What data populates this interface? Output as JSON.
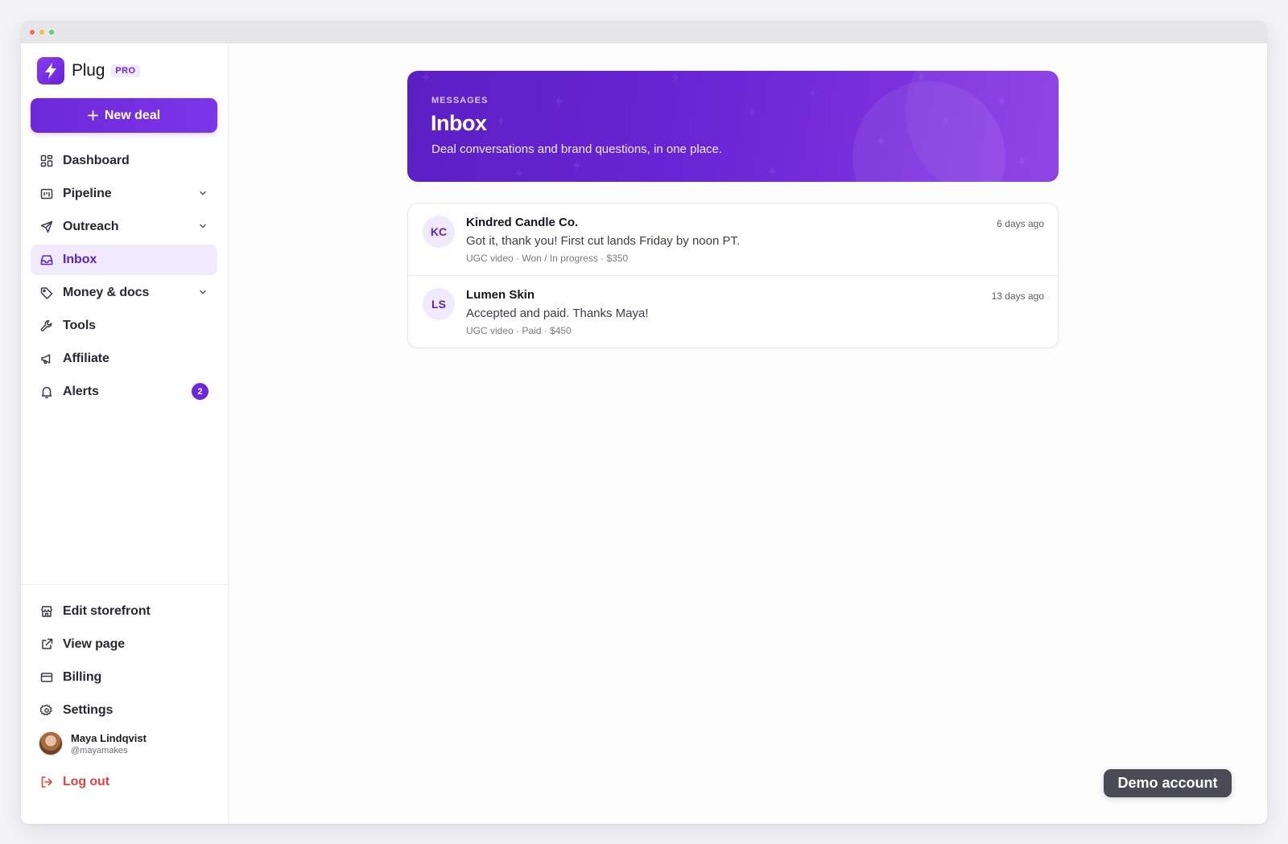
{
  "brand": {
    "name": "Plug",
    "badge": "PRO"
  },
  "sidebar": {
    "new_deal_label": "New deal",
    "items": [
      {
        "label": "Dashboard",
        "icon": "grid-icon",
        "has_chevron": false
      },
      {
        "label": "Pipeline",
        "icon": "pipeline-icon",
        "has_chevron": true
      },
      {
        "label": "Outreach",
        "icon": "send-icon",
        "has_chevron": true
      },
      {
        "label": "Inbox",
        "icon": "inbox-icon",
        "active": true
      },
      {
        "label": "Money & docs",
        "icon": "tag-icon",
        "has_chevron": true
      },
      {
        "label": "Tools",
        "icon": "wrench-icon"
      },
      {
        "label": "Affiliate",
        "icon": "megaphone-icon"
      },
      {
        "label": "Alerts",
        "icon": "bell-icon",
        "badge": "2"
      }
    ],
    "bottom_items": [
      {
        "label": "Edit storefront",
        "icon": "storefront-icon"
      },
      {
        "label": "View page",
        "icon": "external-link-icon"
      },
      {
        "label": "Billing",
        "icon": "credit-card-icon"
      },
      {
        "label": "Settings",
        "icon": "gear-icon"
      }
    ],
    "user": {
      "name": "Maya Lindqvist",
      "handle": "@mayamakes"
    },
    "logout_label": "Log out"
  },
  "hero": {
    "kicker": "MESSAGES",
    "title": "Inbox",
    "subtitle": "Deal conversations and brand questions, in one place."
  },
  "conversations": [
    {
      "initials": "KC",
      "name": "Kindred Candle Co.",
      "message": "Got it, thank you! First cut lands Friday by noon PT.",
      "meta": "UGC video · Won / In progress · $350",
      "time": "6 days ago"
    },
    {
      "initials": "LS",
      "name": "Lumen Skin",
      "message": "Accepted and paid. Thanks Maya!",
      "meta": "UGC video · Paid · $450",
      "time": "13 days ago"
    }
  ],
  "demo_label": "Demo account",
  "colors": {
    "accent": "#6d28d9",
    "accent_soft": "#f1eafd",
    "danger": "#e0443f"
  }
}
